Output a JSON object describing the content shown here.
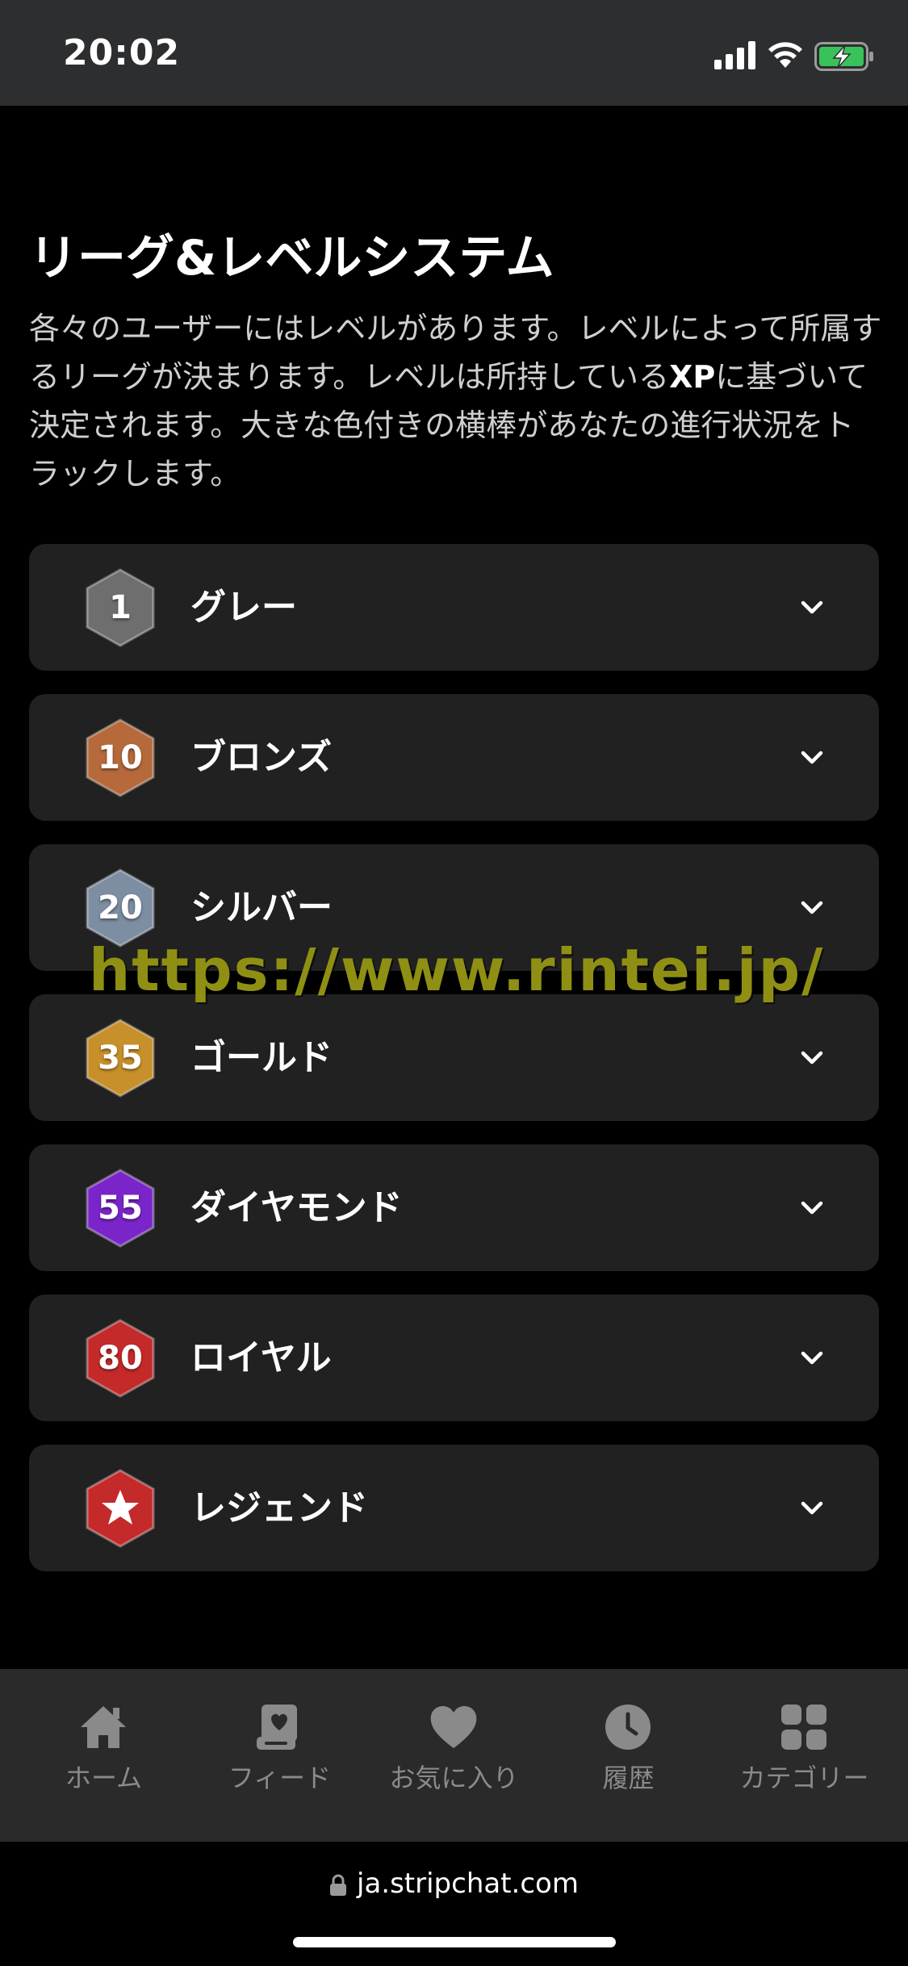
{
  "status_bar": {
    "time": "20:02"
  },
  "page": {
    "title": "リーグ&レベルシステム",
    "description_part1": "各々のユーザーにはレベルがあります。レベルによって所属するリーグが決まります。レベルは所持している",
    "description_bold": "XP",
    "description_part2": "に基づいて決定されます。大きな色付きの横棒があなたの進行状況をトラックします。"
  },
  "leagues": [
    {
      "level": "1",
      "label": "グレー",
      "color": "#6e6e6e"
    },
    {
      "level": "10",
      "label": "ブロンズ",
      "color": "#b66a3b"
    },
    {
      "level": "20",
      "label": "シルバー",
      "color": "#7d8ea3"
    },
    {
      "level": "35",
      "label": "ゴールド",
      "color": "#c8902a"
    },
    {
      "level": "55",
      "label": "ダイヤモンド",
      "color": "#7a25c9"
    },
    {
      "level": "80",
      "label": "ロイヤル",
      "color": "#c42a2a"
    },
    {
      "level": "",
      "label": "レジェンド",
      "color": "#c42a2a",
      "icon": "star-icon"
    }
  ],
  "watermark": "https://www.rintei.jp/",
  "tab_bar": [
    {
      "label": "ホーム",
      "icon": "home-icon"
    },
    {
      "label": "フィード",
      "icon": "feed-icon"
    },
    {
      "label": "お気に入り",
      "icon": "heart-icon"
    },
    {
      "label": "履歴",
      "icon": "clock-icon"
    },
    {
      "label": "カテゴリー",
      "icon": "grid-icon"
    }
  ],
  "url_bar": {
    "url": "ja.stripchat.com"
  }
}
